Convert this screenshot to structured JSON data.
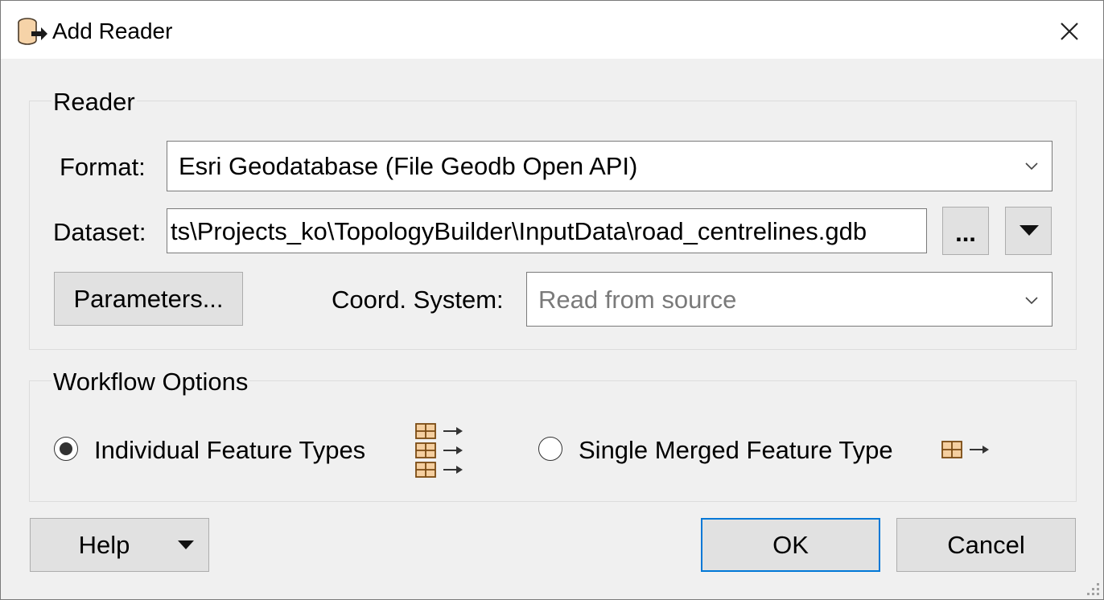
{
  "window": {
    "title": "Add Reader"
  },
  "reader": {
    "group_title": "Reader",
    "format_label": "Format:",
    "format_value": "Esri Geodatabase (File Geodb Open API)",
    "dataset_label": "Dataset:",
    "dataset_value": "ts\\Projects_ko\\TopologyBuilder\\InputData\\road_centrelines.gdb",
    "browse_label": "...",
    "parameters_label": "Parameters...",
    "coord_label": "Coord. System:",
    "coord_placeholder": "Read from source"
  },
  "workflow": {
    "group_title": "Workflow Options",
    "option_individual": "Individual Feature Types",
    "option_merged": "Single Merged Feature Type",
    "selected": "Individual Feature Types"
  },
  "footer": {
    "help_label": "Help",
    "ok_label": "OK",
    "cancel_label": "Cancel"
  },
  "icons": {
    "app": "database-reader-icon",
    "close": "close-icon",
    "feature_type": "table-arrow-icon",
    "accent": "#0078d7",
    "icon_fill": "#f5cfa0",
    "icon_stroke": "#7a4a12"
  }
}
